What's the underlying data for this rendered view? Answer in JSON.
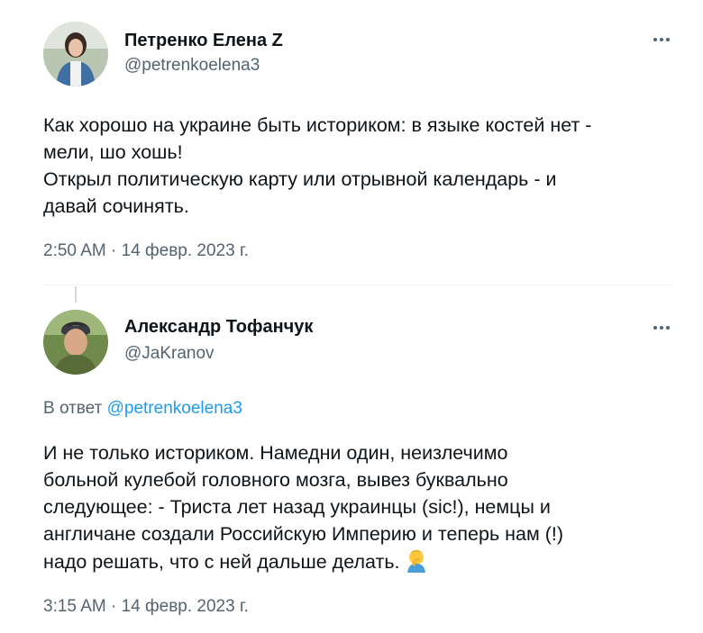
{
  "tweet1": {
    "author_name": "Петренко Елена Z",
    "handle": "@petrenkoelena3",
    "text_lines": [
      "Как хорошо на украине быть историком: в языке костей нет -",
      "мели, шо хошь!",
      "Открыл политическую карту или отрывной календарь - и",
      "давай сочинять."
    ],
    "timestamp": "2:50 AM · 14 февр. 2023 г."
  },
  "tweet2": {
    "author_name": "Александр Тофанчук",
    "handle": "@JaKranov",
    "reply_prefix": "В ответ",
    "reply_handle": "@petrenkoelena3",
    "text_lines": [
      "И не только историком. Намедни один, неизлечимо",
      "больной кулебой головного мозга, вывез буквально",
      "следующее: - Триста лет назад украинцы (sic!), немцы и",
      "англичане создали Российскую Империю и теперь нам (!)",
      "надо решать, что с ней дальше делать."
    ],
    "emoji": "facepalm-person-emoji",
    "timestamp": "3:15 AM · 14 февр. 2023 г."
  },
  "colors": {
    "text_primary": "#0f1419",
    "text_secondary": "#536471",
    "link": "#1d9bf0",
    "divider": "#eff3f4"
  }
}
